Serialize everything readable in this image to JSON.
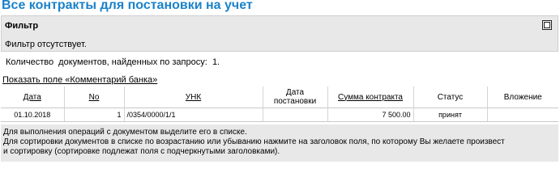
{
  "page": {
    "title": "Все контракты для постановки на учет"
  },
  "filter": {
    "title": "Фильтр",
    "status": "Фильтр отсутствует."
  },
  "count": {
    "label": "Количество  документов, найденных по запросу:",
    "value": "1."
  },
  "show_comment_link": "Показать поле «Комментарий банка»",
  "table": {
    "columns": [
      {
        "label": "Дата",
        "sortable": true
      },
      {
        "label": "No",
        "sortable": true
      },
      {
        "label": "УНК",
        "sortable": true
      },
      {
        "label": "Дата постановки",
        "sortable": false
      },
      {
        "label": "Сумма контракта",
        "sortable": true
      },
      {
        "label": "Статус",
        "sortable": false
      },
      {
        "label": "Вложение",
        "sortable": false
      }
    ],
    "rows": [
      {
        "date": "01.10.2018",
        "no": "1",
        "unk": "/0354/0000/1/1",
        "reg_date": "",
        "amount": "7 500.00",
        "status": "принят",
        "attachment": ""
      }
    ]
  },
  "footer": {
    "line1": "Для выполнения операций с документом выделите его в списке.",
    "line2": "Для сортировки документов в списке по возрастанию или убыванию нажмите на заголовок поля, по которому Вы желаете произвест",
    "line3": "и сортировку (сортировке подлежат поля с подчеркнутыми заголовками)."
  }
}
